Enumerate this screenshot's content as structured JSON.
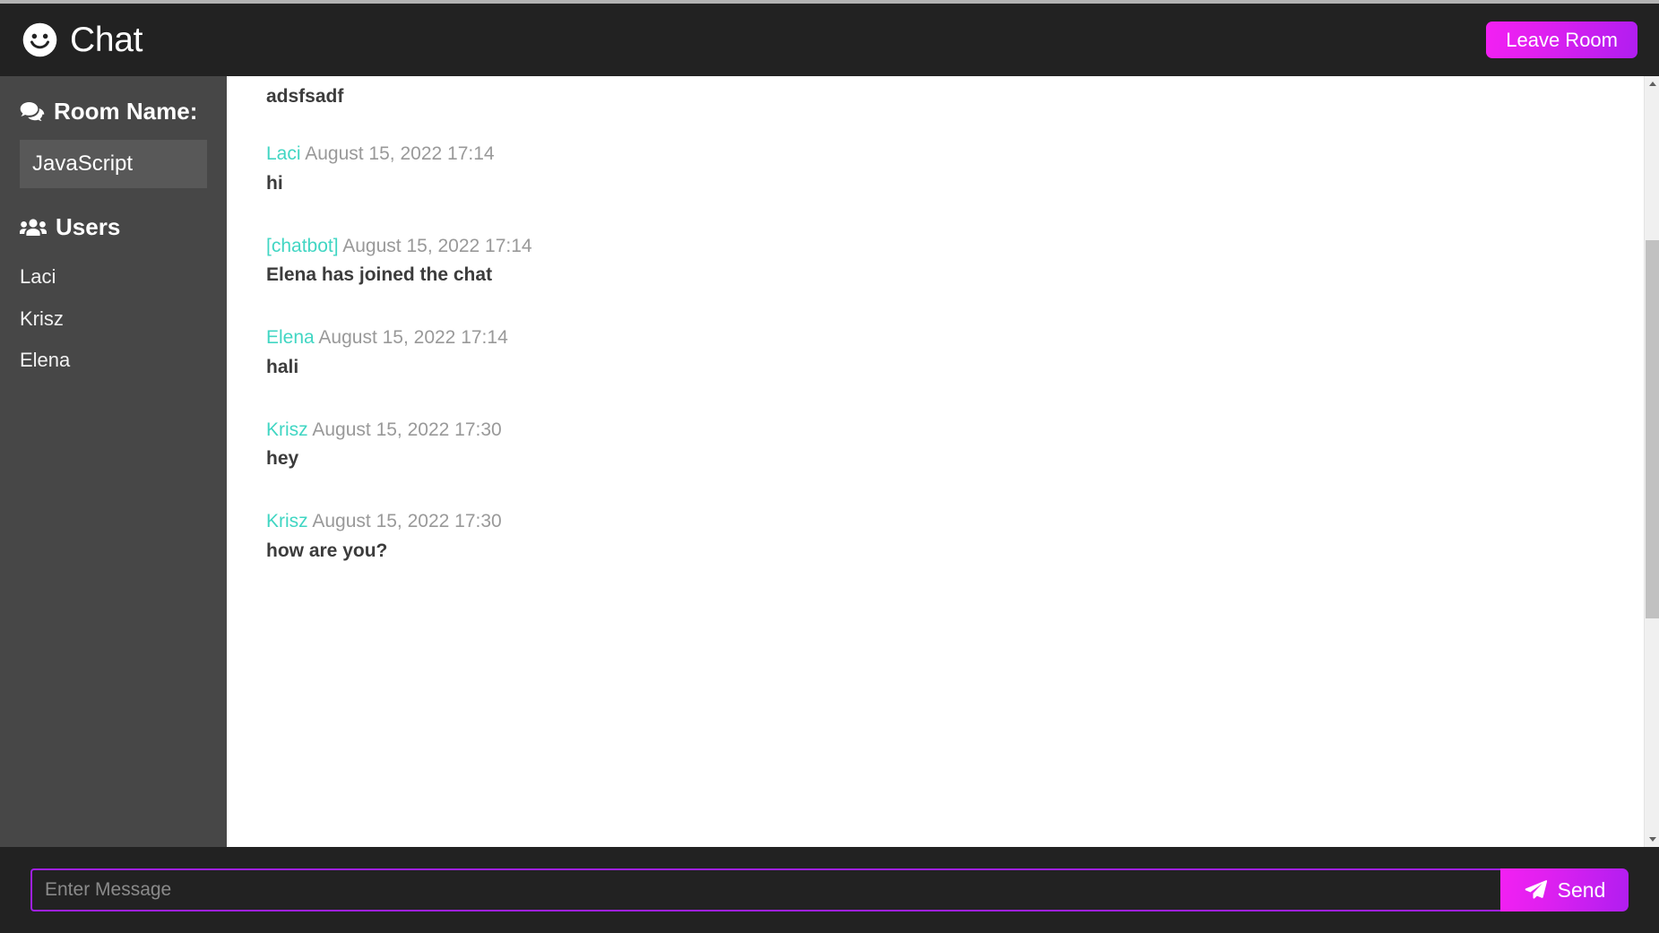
{
  "header": {
    "logo_icon": "smiley-face-icon",
    "title": "Chat",
    "leave_room_label": "Leave Room",
    "background_color": "#222222",
    "accent_gradient_from": "#f320f3",
    "accent_gradient_to": "#b01ef0"
  },
  "sidebar": {
    "background_color": "#474747",
    "room_name_heading": "Room Name:",
    "room_name_icon": "comments-icon",
    "room_name_value": "JavaScript",
    "users_heading": "Users",
    "users_icon": "users-icon",
    "users": [
      {
        "name": "Laci"
      },
      {
        "name": "Krisz"
      },
      {
        "name": "Elena"
      }
    ]
  },
  "chat": {
    "username_color": "#41d6c3",
    "timestamp_color": "#999999",
    "text_color": "#3c3c3c",
    "orphan_message_text": "adsfsadf",
    "messages": [
      {
        "user": "Laci",
        "time": "August 15, 2022 17:14",
        "text": "hi"
      },
      {
        "user": "[chatbot]",
        "time": "August 15, 2022 17:14",
        "text": "Elena has joined the chat"
      },
      {
        "user": "Elena",
        "time": "August 15, 2022 17:14",
        "text": "hali"
      },
      {
        "user": "Krisz",
        "time": "August 15, 2022 17:30",
        "text": "hey"
      },
      {
        "user": "Krisz",
        "time": "August 15, 2022 17:30",
        "text": "how are you?"
      }
    ]
  },
  "composer": {
    "input_value": "",
    "input_placeholder": "Enter Message",
    "send_label": "Send",
    "send_icon": "paper-plane-icon",
    "input_border_color": "#a020e8"
  },
  "scrollbar": {
    "up_arrow_icon": "triangle-up-icon",
    "down_arrow_icon": "triangle-down-icon"
  }
}
